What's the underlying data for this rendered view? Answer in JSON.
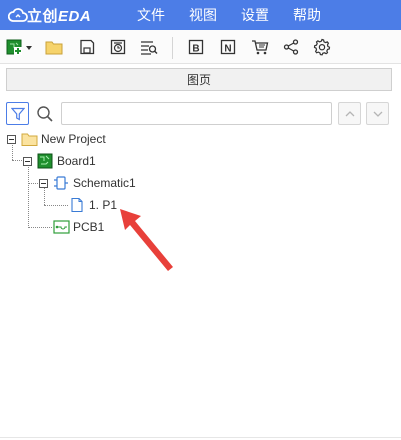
{
  "app": {
    "logo_text_cn": "立创",
    "logo_text_en": "EDA"
  },
  "menu": {
    "items": [
      "文件",
      "视图",
      "设置",
      "帮助"
    ]
  },
  "toolbar": {
    "icons": [
      "new-project-icon",
      "open-folder-icon",
      "save-icon",
      "history-icon",
      "search-document-icon",
      "bom-icon",
      "netlist-icon",
      "cart-icon",
      "share-icon",
      "settings-icon"
    ]
  },
  "panel": {
    "tab_label": "图页",
    "search_placeholder": ""
  },
  "tree": {
    "project": "New Project",
    "board": "Board1",
    "schematic": "Schematic1",
    "page": "1. P1",
    "pcb": "PCB1"
  },
  "colors": {
    "accent": "#4c7de7",
    "arrow": "#e8403a",
    "folder": "#f6d36b",
    "board_green": "#1f8f2d",
    "pcb_green": "#2f9e3a",
    "schematic_blue": "#3a7bd5"
  }
}
